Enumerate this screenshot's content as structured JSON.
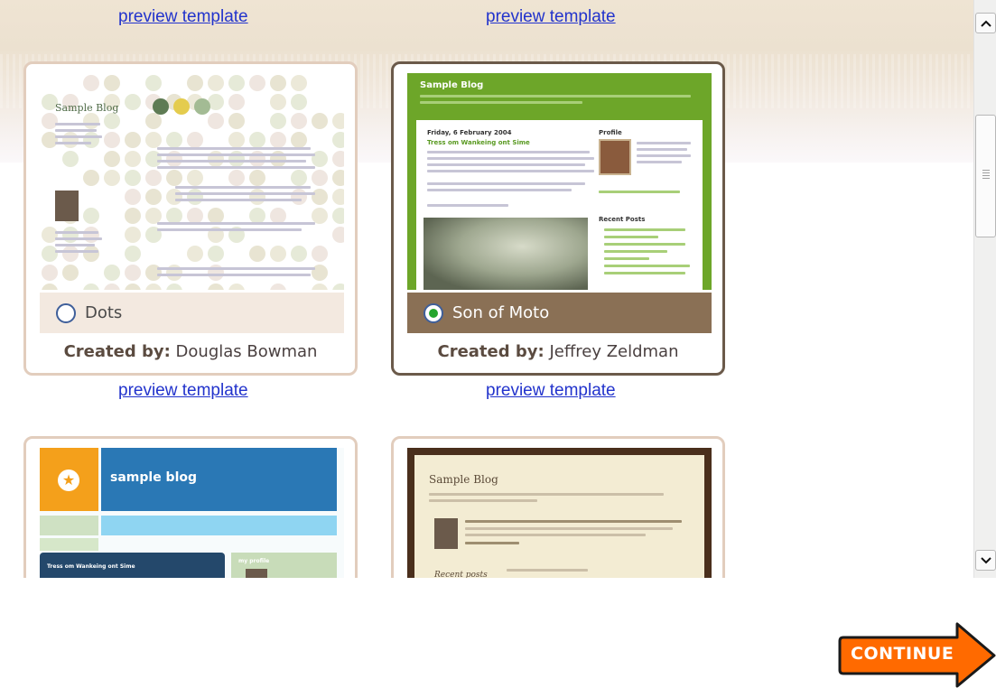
{
  "templates": [
    {
      "name": "Dots",
      "created_by_label": "Created by:",
      "author": "Douglas Bowman",
      "selected": false,
      "preview_link": "preview template",
      "thumb_title": "Sample Blog"
    },
    {
      "name": "Son of Moto",
      "created_by_label": "Created by:",
      "author": "Jeffrey Zeldman",
      "selected": true,
      "preview_link": "preview template",
      "thumb_title": "Sample Blog",
      "thumb_date": "Friday, 6 February 2004",
      "thumb_post_title": "Tress om Wankeing ont Sime",
      "thumb_profile": "Profile",
      "thumb_recent": "Recent Posts"
    },
    {
      "thumb_title": "sample blog",
      "thumb_post_title": "Tress om Wankeing ont Sime",
      "thumb_profile": "my profile"
    },
    {
      "thumb_title": "Sample Blog",
      "thumb_recent": "Recent posts"
    }
  ],
  "top_links": [
    "preview template",
    "preview template"
  ],
  "continue_label": "CONTINUE",
  "colors": {
    "link": "#2233cc",
    "selected_border": "#6b5a4a",
    "unselected_border": "#e2cdbd",
    "dots_namebar": "#f3e9e0",
    "moto_namebar": "#8a7055",
    "moto_green": "#6da629",
    "continue_orange": "#ff6a00"
  },
  "icons": {
    "scroll_up": "chevron-up-icon",
    "scroll_down": "chevron-down-icon",
    "continue_arrow": "arrow-right-icon"
  }
}
